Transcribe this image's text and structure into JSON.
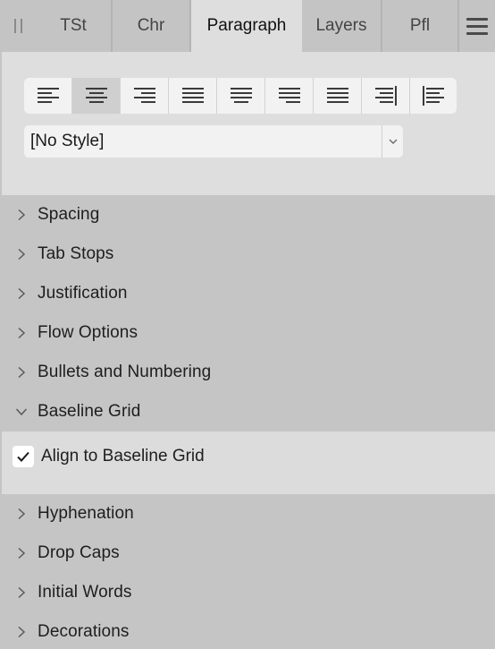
{
  "tabs": [
    {
      "label": "TSt",
      "active": false
    },
    {
      "label": "Chr",
      "active": false
    },
    {
      "label": "Paragraph",
      "active": true
    },
    {
      "label": "Layers",
      "active": false
    },
    {
      "label": "Pfl",
      "active": false
    }
  ],
  "alignment_buttons": [
    {
      "icon": "align-left-icon",
      "active": false
    },
    {
      "icon": "align-center-icon",
      "active": true
    },
    {
      "icon": "align-right-icon",
      "active": false
    },
    {
      "icon": "justify-left-icon",
      "active": false
    },
    {
      "icon": "justify-center-icon",
      "active": false
    },
    {
      "icon": "justify-right-icon",
      "active": false
    },
    {
      "icon": "justify-all-icon",
      "active": false
    },
    {
      "icon": "align-towards-spine-icon",
      "active": false
    },
    {
      "icon": "align-away-from-spine-icon",
      "active": false
    }
  ],
  "paragraph_style": {
    "value": "[No Style]"
  },
  "sections": {
    "spacing": "Spacing",
    "tab_stops": "Tab Stops",
    "justification": "Justification",
    "flow_options": "Flow Options",
    "bullets": "Bullets and Numbering",
    "baseline_grid": "Baseline Grid",
    "hyphenation": "Hyphenation",
    "drop_caps": "Drop Caps",
    "initial_words": "Initial Words",
    "decorations": "Decorations"
  },
  "baseline_grid": {
    "align_label": "Align to Baseline Grid",
    "align_checked": true
  },
  "colors": {
    "panel_bg": "#c5c5c5",
    "active_bg": "#dedede",
    "control_bg": "#f2f2f2",
    "pressed_bg": "#cfcfcf"
  }
}
